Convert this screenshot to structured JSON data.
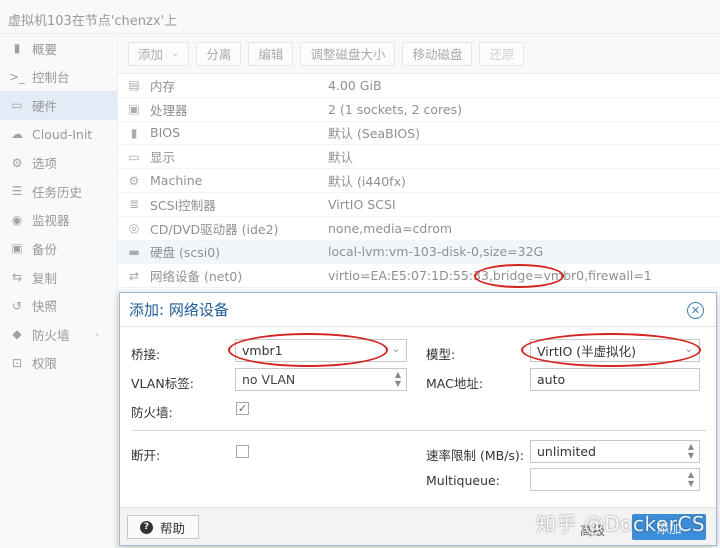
{
  "window": {
    "title": "虚拟机103在节点'chenzx'上"
  },
  "sidebar": {
    "items": [
      {
        "label": "概要",
        "icon": "book-icon"
      },
      {
        "label": "控制台",
        "icon": "terminal-icon"
      },
      {
        "label": "硬件",
        "icon": "monitor-icon",
        "active": true
      },
      {
        "label": "Cloud-Init",
        "icon": "cloud-icon"
      },
      {
        "label": "选项",
        "icon": "gear-icon"
      },
      {
        "label": "任务历史",
        "icon": "list-icon"
      },
      {
        "label": "监视器",
        "icon": "eye-icon"
      },
      {
        "label": "备份",
        "icon": "floppy-icon"
      },
      {
        "label": "复制",
        "icon": "retweet-icon"
      },
      {
        "label": "快照",
        "icon": "history-icon"
      },
      {
        "label": "防火墙",
        "icon": "shield-icon",
        "chevron": "›"
      },
      {
        "label": "权限",
        "icon": "unlock-icon"
      }
    ]
  },
  "toolbar": {
    "add": "添加",
    "add_caret": "⌄",
    "detach": "分离",
    "edit": "编辑",
    "resize": "调整磁盘大小",
    "move": "移动磁盘",
    "revert": "还原"
  },
  "hardware": [
    {
      "icon": "memory-icon",
      "glyph": "▤",
      "name": "内存",
      "value": "4.00 GiB"
    },
    {
      "icon": "cpu-icon",
      "glyph": "▣",
      "name": "处理器",
      "value": "2 (1 sockets, 2 cores)"
    },
    {
      "icon": "bios-icon",
      "glyph": "▮",
      "name": "BIOS",
      "value": "默认 (SeaBIOS)"
    },
    {
      "icon": "display-icon",
      "glyph": "▭",
      "name": "显示",
      "value": "默认"
    },
    {
      "icon": "machine-icon",
      "glyph": "⚙",
      "name": "Machine",
      "value": "默认 (i440fx)"
    },
    {
      "icon": "database-icon",
      "glyph": "≣",
      "name": "SCSI控制器",
      "value": "VirtIO SCSI"
    },
    {
      "icon": "cdrom-icon",
      "glyph": "◎",
      "name": "CD/DVD驱动器 (ide2)",
      "value": "none,media=cdrom"
    },
    {
      "icon": "hdd-icon",
      "glyph": "▬",
      "name": "硬盘 (scsi0)",
      "value": "local-lvm:vm-103-disk-0,size=32G"
    },
    {
      "icon": "network-icon",
      "glyph": "⇄",
      "name": "网络设备 (net0)",
      "value": "virtio=EA:E5:07:1D:55:33,bridge=vmbr0,firewall=1"
    }
  ],
  "dialog": {
    "title": "添加: 网络设备",
    "close_glyph": "✕",
    "bridge_label": "桥接:",
    "bridge_value": "vmbr1",
    "vlan_label": "VLAN标签:",
    "vlan_value": "no VLAN",
    "firewall_label": "防火墙:",
    "firewall_check": "✓",
    "model_label": "模型:",
    "model_value": "VirtIO (半虚拟化)",
    "mac_label": "MAC地址:",
    "mac_value": "auto",
    "disconnect_label": "断开:",
    "rate_label": "速率限制 (MB/s):",
    "rate_value": "unlimited",
    "multiqueue_label": "Multiqueue:",
    "multiqueue_value": "",
    "help": "帮助",
    "help_glyph": "?",
    "advanced": "高级",
    "add": "添加"
  },
  "watermark": "知乎 @DockerCS",
  "colors": {
    "accent": "#3c8dd7",
    "header_text": "#1e5b94",
    "annotation": "#d4231e",
    "selected_row": "#c9dcef"
  }
}
